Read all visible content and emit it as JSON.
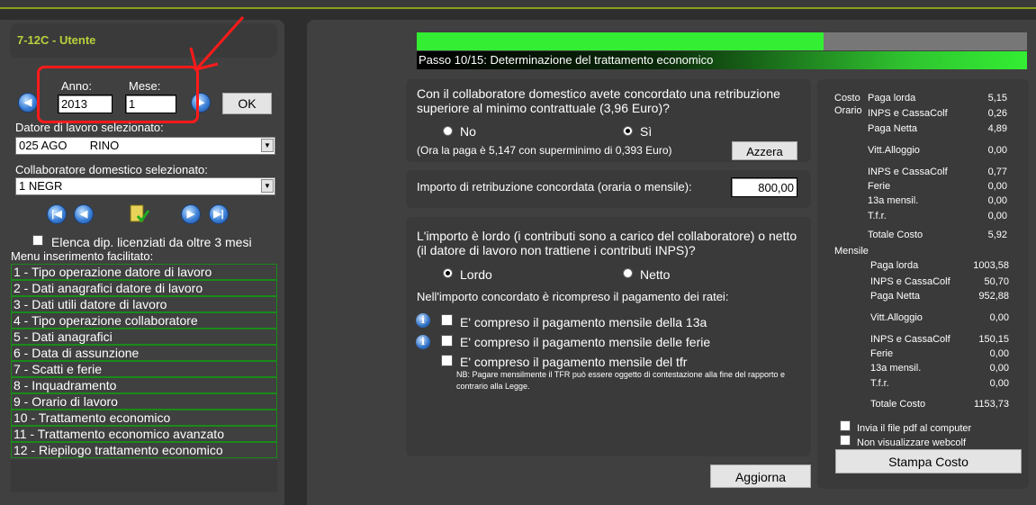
{
  "header": {
    "title": "7-12C - Utente"
  },
  "period": {
    "year_label": "Anno:",
    "year_value": "2013",
    "month_label": "Mese:",
    "month_value": "1",
    "ok_label": "OK"
  },
  "employer": {
    "label": "Datore di lavoro selezionato:",
    "value": "025 AGO       RINO"
  },
  "worker": {
    "label": "Collaboratore domestico selezionato:",
    "value": "1 NEGR"
  },
  "list_dismissed": {
    "label": "Elenca dip. licenziati da oltre 3 mesi"
  },
  "menu": {
    "title": "Menu inserimento facilitato:",
    "items": [
      "1 - Tipo operazione datore di lavoro",
      "2 - Dati anagrafici datore di lavoro",
      "3 - Dati utili datore di lavoro",
      "4 - Tipo operazione collaboratore",
      "5 - Dati anagrafici",
      "6 - Data di assunzione",
      "7 - Scatti e ferie",
      "8 - Inquadramento",
      "9 - Orario di lavoro",
      "10 - Trattamento economico",
      "11 - Trattamento economico avanzato",
      "12 - Riepilogo trattamento economico"
    ]
  },
  "progress": {
    "label": "Passo 10/15: Determinazione del trattamento economico",
    "fraction": 0.667
  },
  "q1": {
    "text": "Con il collaboratore domestico avete concordato una retribuzione superiore al minimo contrattuale (3,96 Euro)?",
    "no": "No",
    "yes": "Sì",
    "note": "(Ora la paga è 5,147 con superminimo di 0,393 Euro)",
    "reset": "Azzera"
  },
  "amount": {
    "label": "Importo di retribuzione concordata (oraria o mensile):",
    "value": "800,00"
  },
  "q2": {
    "text": "L'importo è lordo (i contributi sono a carico del collaboratore) o netto (il datore di lavoro non trattiene i contributi INPS)?",
    "gross": "Lordo",
    "net": "Netto",
    "included_title": "Nell'importo concordato è ricompreso il pagamento dei ratei:",
    "opt13": "E' compreso il pagamento mensile della 13a",
    "optferie": "E' compreso il pagamento mensile delle ferie",
    "opttfr": "E' compreso il pagamento mensile del tfr",
    "nb": "NB: Pagare mensilmente il TFR può essere oggetto di contestazione alla fine del rapporto e contrario alla Legge."
  },
  "update_label": "Aggiorna",
  "cost": {
    "hourly_label1": "Costo",
    "hourly_label2": "Orario",
    "hourly": [
      {
        "label": "Paga lorda",
        "value": "5,15"
      },
      {
        "label": "INPS e CassaColf",
        "value": "0,26"
      },
      {
        "label": "Paga Netta",
        "value": "4,89"
      },
      {
        "label": "Vitt.Alloggio",
        "value": "0,00"
      },
      {
        "label": "INPS e CassaColf",
        "value": "0,77"
      },
      {
        "label": "Ferie",
        "value": "0,00"
      },
      {
        "label": "13a mensil.",
        "value": "0,00"
      },
      {
        "label": "T.f.r.",
        "value": "0,00"
      },
      {
        "label": "Totale Costo",
        "value": "5,92"
      }
    ],
    "monthly_label": "Mensile",
    "monthly": [
      {
        "label": "Paga lorda",
        "value": "1003,58"
      },
      {
        "label": "INPS e CassaColf",
        "value": "50,70"
      },
      {
        "label": "Paga Netta",
        "value": "952,88"
      },
      {
        "label": "Vitt.Alloggio",
        "value": "0,00"
      },
      {
        "label": "INPS e CassaColf",
        "value": "150,15"
      },
      {
        "label": "Ferie",
        "value": "0,00"
      },
      {
        "label": "13a mensil.",
        "value": "0,00"
      },
      {
        "label": "T.f.r.",
        "value": "0,00"
      },
      {
        "label": "Totale Costo",
        "value": "1153,73"
      }
    ],
    "send_pdf": "Invia il file pdf al computer",
    "no_webcolf": "Non visualizzare webcolf",
    "print_label": "Stampa Costo"
  },
  "colors": {
    "accent": "#b6d23c",
    "progress": "#33ee33",
    "annotation": "#ff1a1a"
  }
}
